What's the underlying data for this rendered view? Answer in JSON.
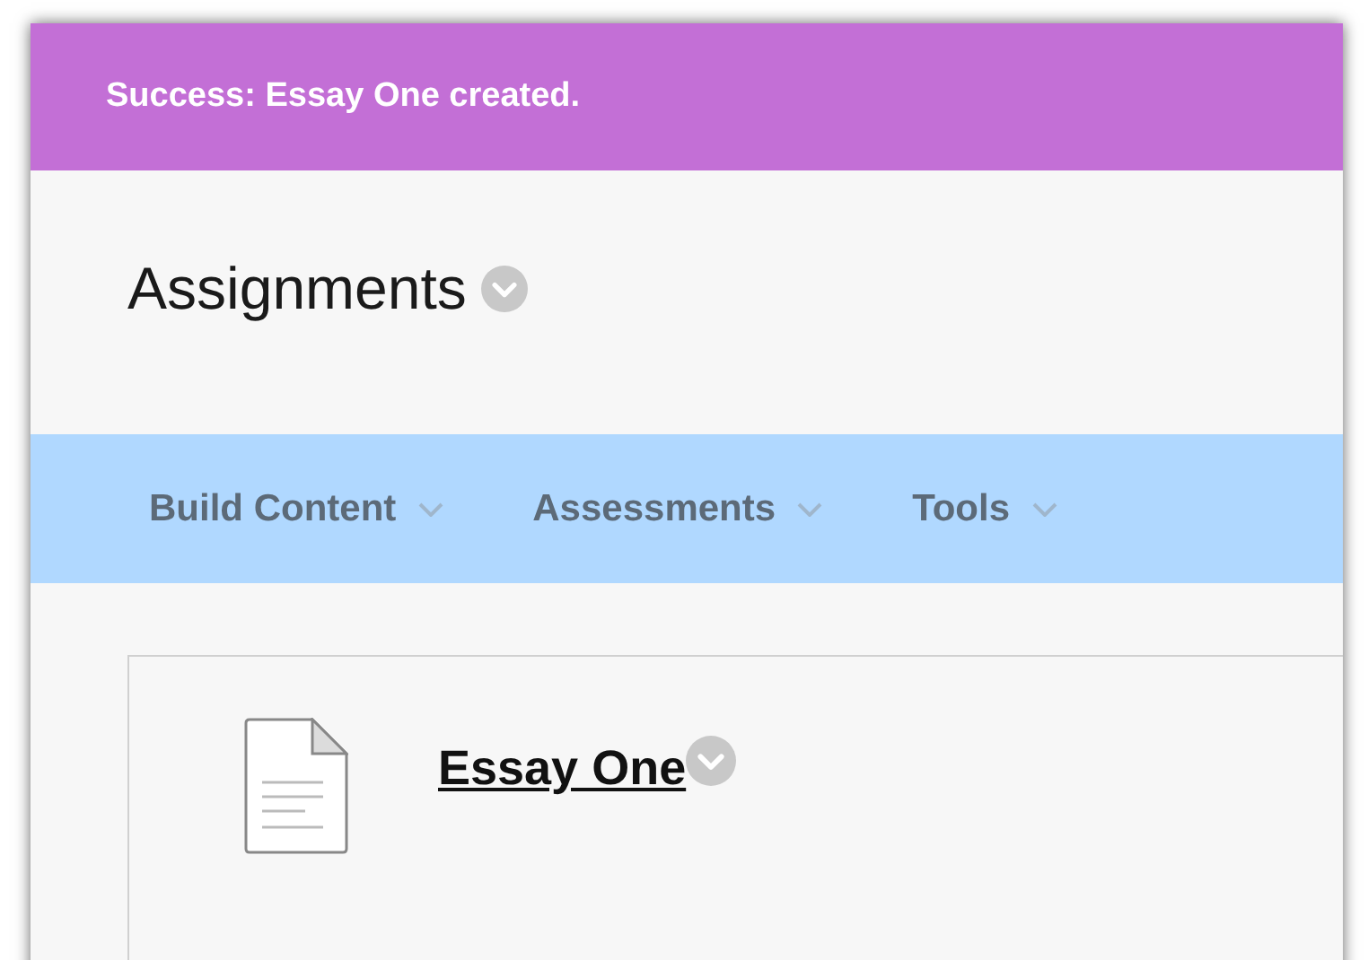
{
  "banner": {
    "message": "Success: Essay One created."
  },
  "page_title": "Assignments",
  "menu": [
    {
      "label": "Build Content"
    },
    {
      "label": "Assessments"
    },
    {
      "label": "Tools"
    }
  ],
  "items": [
    {
      "title": "Essay One"
    }
  ]
}
